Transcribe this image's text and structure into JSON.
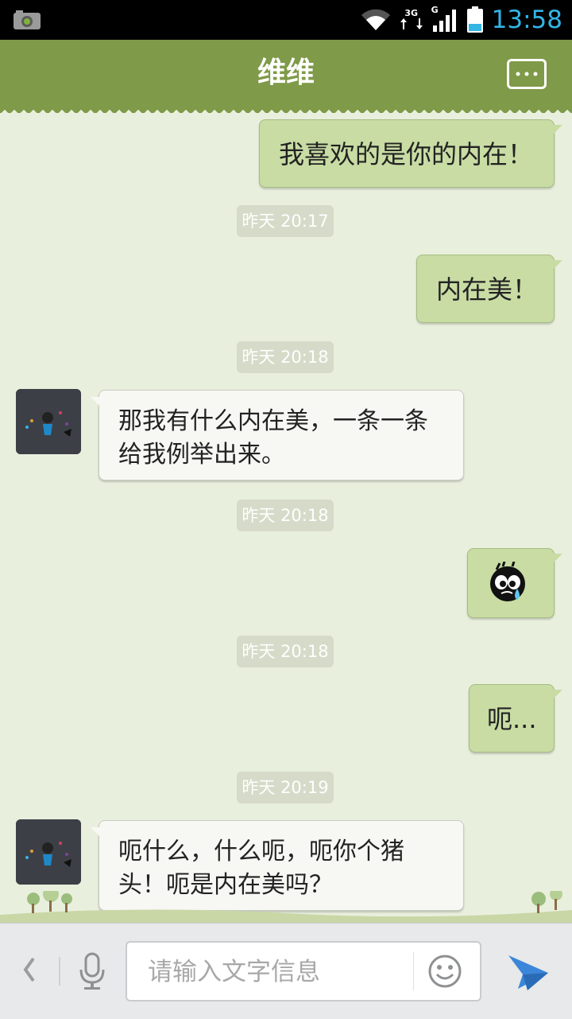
{
  "status_bar": {
    "time": "13:58",
    "network_label": "3G",
    "network_label2": "G"
  },
  "header": {
    "title": "维维"
  },
  "messages": [
    {
      "side": "right",
      "type": "text",
      "text": "我喜欢的是你的内在！"
    },
    {
      "type": "timestamp",
      "text": "昨天 20:17"
    },
    {
      "side": "right",
      "type": "text",
      "text": "内在美！"
    },
    {
      "type": "timestamp",
      "text": "昨天 20:18"
    },
    {
      "side": "left",
      "type": "text",
      "text": "那我有什么内在美，一条一条给我例举出来。"
    },
    {
      "type": "timestamp",
      "text": "昨天 20:18"
    },
    {
      "side": "right",
      "type": "sticker",
      "icon": "crying-face-sticker-icon"
    },
    {
      "type": "timestamp",
      "text": "昨天 20:18"
    },
    {
      "side": "right",
      "type": "text",
      "text": "呃..."
    },
    {
      "type": "timestamp",
      "text": "昨天 20:19"
    },
    {
      "side": "left",
      "type": "text",
      "text": "呃什么，什么呃，呃你个猪头！呃是内在美吗？"
    }
  ],
  "input": {
    "placeholder": "请输入文字信息"
  },
  "colors": {
    "header": "#7f9a48",
    "bubble_out": "#c8dca4",
    "bubble_in": "#f7f8f4",
    "accent_time": "#33b5e5",
    "send": "#3b86d8"
  }
}
